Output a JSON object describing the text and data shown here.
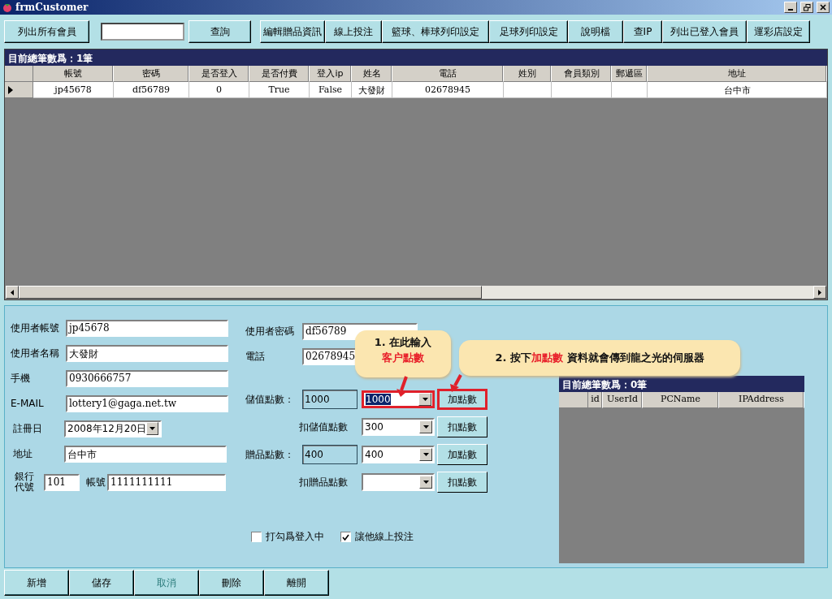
{
  "window": {
    "title": "frmCustomer"
  },
  "toolbar": {
    "list_all_button": "列出所有會員",
    "search_button": "查詢",
    "buttons": [
      "編輯贈品資訊",
      "線上投注",
      "籃球、棒球列印設定",
      "足球列印設定",
      "說明檔",
      "查IP",
      "列出已登入會員",
      "運彩店設定"
    ]
  },
  "grid": {
    "title": "目前總筆數爲：1筆",
    "columns": [
      "帳號",
      "密碼",
      "是否登入",
      "是否付費",
      "登入ip",
      "姓名",
      "電話",
      "姓別",
      "會員類別",
      "郵遞區",
      "地址"
    ],
    "rows": [
      {
        "selected": true,
        "cells": [
          "jp45678",
          "df56789",
          "0",
          "True",
          "False",
          "大發財",
          "02678945",
          null,
          null,
          null,
          "台中市"
        ]
      }
    ]
  },
  "form": {
    "left_fields": [
      {
        "kind": "text",
        "label": "使用者帳號",
        "value": "jp45678"
      },
      {
        "kind": "text",
        "label": "使用者名稱",
        "value": "大發財"
      },
      {
        "kind": "text",
        "label": "手機",
        "value": "0930666757"
      },
      {
        "kind": "text",
        "label": "E-MAIL",
        "value": "lottery1@gaga.net.tw"
      },
      {
        "kind": "date",
        "label": "註冊日",
        "value": "2008年12月20日"
      },
      {
        "kind": "text",
        "label": "地址",
        "value": "台中市"
      }
    ],
    "bank": {
      "code_label": "銀行代號",
      "code": "101",
      "account_label": "帳號",
      "account": "1111111111"
    },
    "right_fields": [
      {
        "label": "使用者密碼",
        "value": "df56789"
      },
      {
        "label": "電話",
        "value": "02678945"
      }
    ],
    "points": [
      {
        "kind": "add",
        "label": "儲值點數：",
        "display": "1000",
        "combo": "1000",
        "combo_selected": true,
        "button": "加點數",
        "highlighted": true
      },
      {
        "kind": "deduct",
        "label": "扣儲值點數",
        "combo": "300",
        "combo_selected": false,
        "button": "扣點數",
        "highlighted": false
      },
      {
        "kind": "add",
        "label": "贈品點數：",
        "display": "400",
        "combo": "400",
        "combo_selected": false,
        "button": "加點數",
        "highlighted": false
      },
      {
        "kind": "deduct",
        "label": "扣贈品點數",
        "button": "扣點數",
        "highlighted": false
      }
    ],
    "checkboxes": [
      {
        "label": "打勾爲登入中",
        "checked": false
      },
      {
        "label": "讓他線上投注",
        "checked": true
      }
    ]
  },
  "login_grid": {
    "title": "目前總筆數爲：0筆",
    "columns": [
      "id",
      "UserId",
      "PCName",
      "IPAddress"
    ]
  },
  "callouts": [
    {
      "lines": [
        [
          {
            "text": "1. 在此輸入",
            "highlight": false
          }
        ],
        [
          {
            "text": "客户點數",
            "highlight": true
          }
        ]
      ]
    },
    {
      "lines": [
        [
          {
            "text": "2. 按下",
            "highlight": false
          },
          {
            "text": "加點數",
            "highlight": true
          },
          {
            "text": " 資料就會傳到龍之光的伺服器",
            "highlight": false
          }
        ]
      ]
    }
  ],
  "bottom_buttons": [
    {
      "label": "新增",
      "disabled": false
    },
    {
      "label": "儲存",
      "disabled": false
    },
    {
      "label": "取消",
      "disabled": true
    },
    {
      "label": "刪除",
      "disabled": false
    },
    {
      "label": "離開",
      "disabled": false
    }
  ]
}
